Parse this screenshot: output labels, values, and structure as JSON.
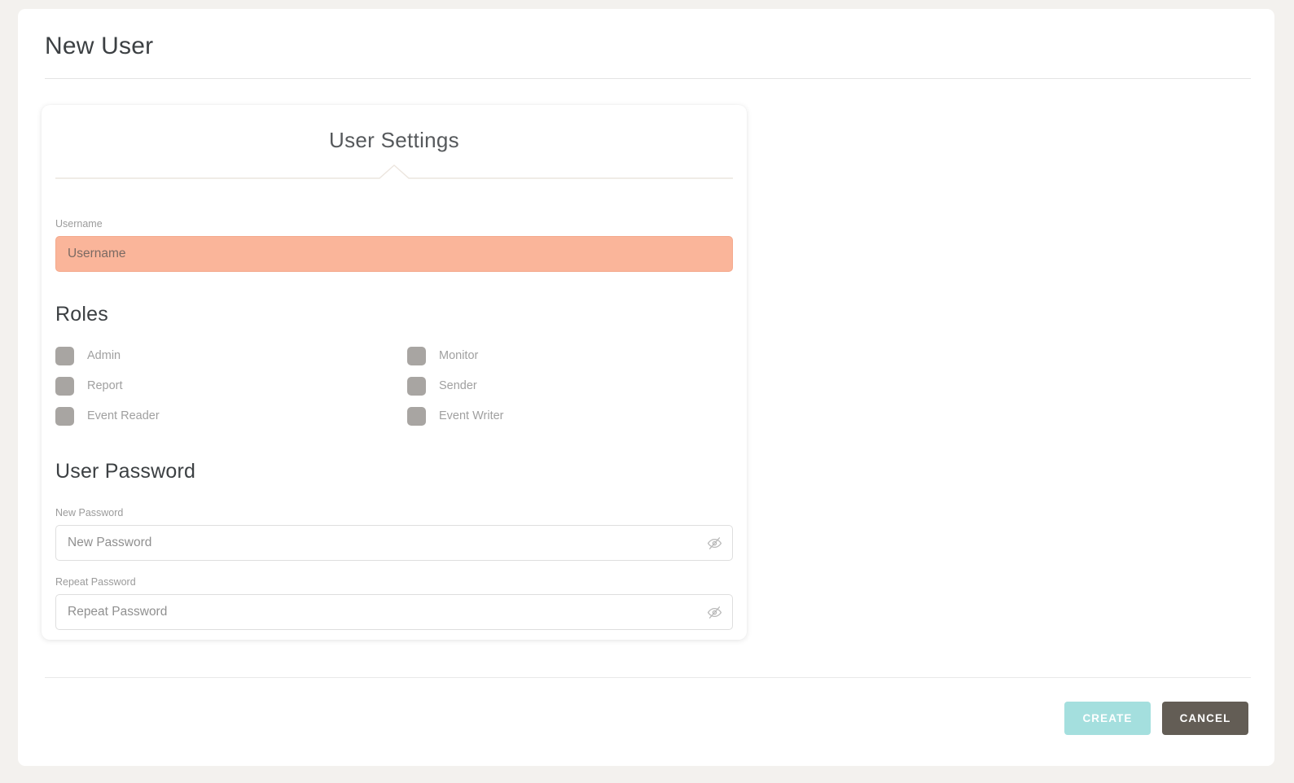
{
  "header": {
    "title": "New User"
  },
  "card": {
    "title": "User Settings",
    "username": {
      "label": "Username",
      "placeholder": "Username",
      "value": "",
      "state": "error",
      "error_color": "#fab59a"
    },
    "roles": {
      "heading": "Roles",
      "items": [
        {
          "label": "Admin",
          "checked": false,
          "column": "left"
        },
        {
          "label": "Report",
          "checked": false,
          "column": "left"
        },
        {
          "label": "Event Reader",
          "checked": false,
          "column": "left"
        },
        {
          "label": "Monitor",
          "checked": false,
          "column": "right"
        },
        {
          "label": "Sender",
          "checked": false,
          "column": "right"
        },
        {
          "label": "Event Writer",
          "checked": false,
          "column": "right"
        }
      ],
      "checkbox_color": "#a8a5a2"
    },
    "password": {
      "heading": "User Password",
      "new": {
        "label": "New Password",
        "placeholder": "New Password",
        "value": "",
        "toggle_icon": "eye-off-icon"
      },
      "repeat": {
        "label": "Repeat Password",
        "placeholder": "Repeat Password",
        "value": "",
        "toggle_icon": "eye-off-icon"
      }
    }
  },
  "footer": {
    "create_label": "CREATE",
    "cancel_label": "CANCEL",
    "create_color": "#a4dfde",
    "cancel_color": "#635d55"
  }
}
